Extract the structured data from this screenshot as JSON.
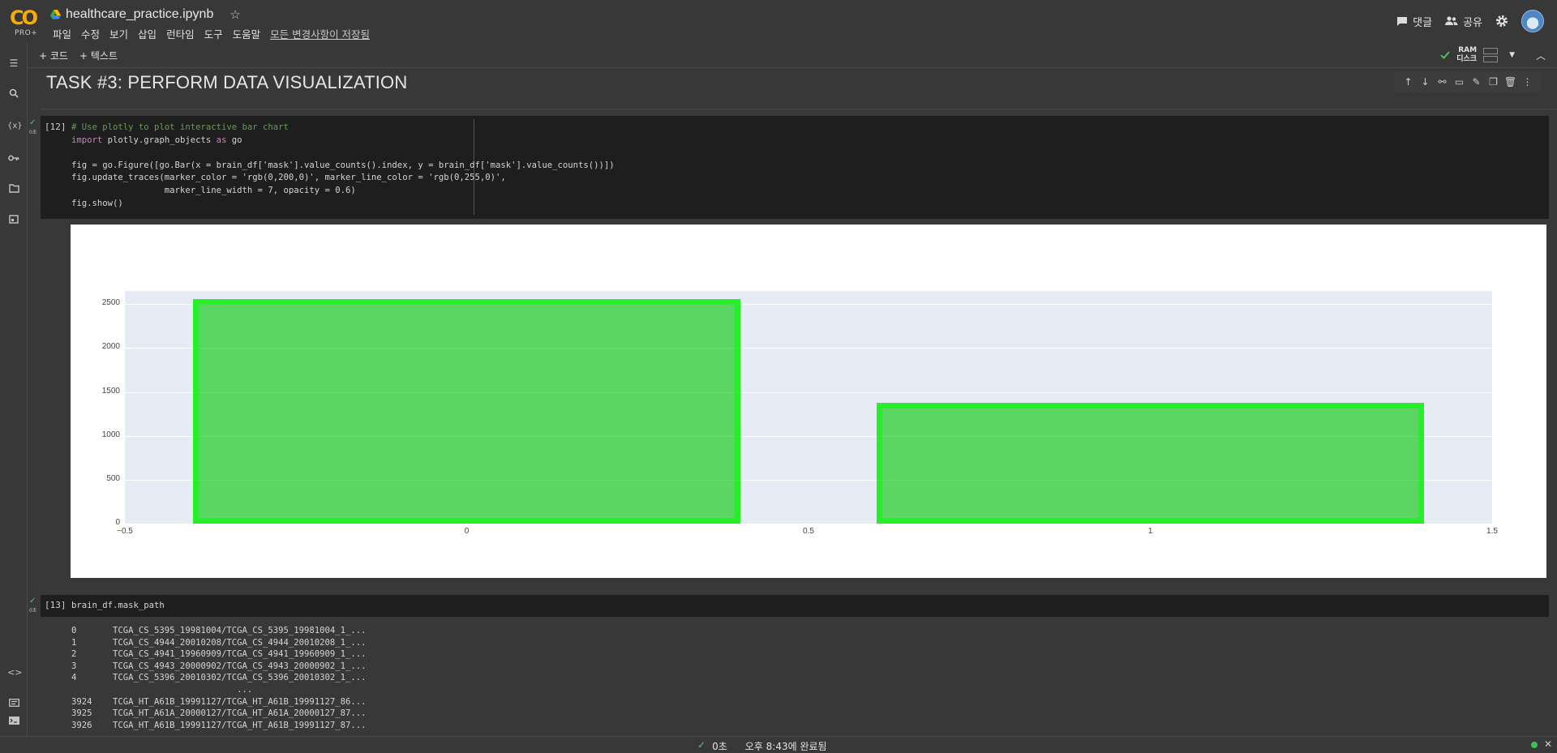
{
  "header": {
    "logo_text": "CO",
    "logo_badge": "PRO+",
    "notebook_title": "healthcare_practice.ipynb",
    "menu": [
      "파일",
      "수정",
      "보기",
      "삽입",
      "런타임",
      "도구",
      "도움말"
    ],
    "saved_status": "모든 변경사항이 저장됨",
    "comments_label": "댓글",
    "share_label": "공유"
  },
  "toolbar": {
    "add_code_label": "+ 코드",
    "add_text_label": "+ 텍스트",
    "ram_label": "RAM",
    "disk_label": "디스크"
  },
  "heading": "TASK #3: PERFORM DATA VISUALIZATION",
  "cell12": {
    "exec_count": "[12]",
    "run_time": "0초",
    "line1": "# Use plotly to plot interactive bar chart",
    "line2a": "import",
    "line2b": " plotly.graph_objects ",
    "line2c": "as",
    "line2d": " go",
    "line4": "fig = go.Figure([go.Bar(x = brain_df['mask'].value_counts().index, y = brain_df['mask'].value_counts())])",
    "line5": "fig.update_traces(marker_color = 'rgb(0,200,0)', marker_line_color = 'rgb(0,255,0)',",
    "line6": "                  marker_line_width = 7, opacity = 0.6)",
    "line7": "fig.show()"
  },
  "chart_data": {
    "type": "bar",
    "x": [
      0,
      1
    ],
    "values": [
      2556,
      1373
    ],
    "xlim": [
      -0.5,
      1.5
    ],
    "ylim": [
      0,
      2650
    ],
    "yticks": [
      0,
      500,
      1000,
      1500,
      2000,
      2500
    ],
    "xtick_labels": [
      "−0.5",
      "0",
      "0.5",
      "1",
      "1.5"
    ],
    "ytick_labels": [
      "0",
      "500",
      "1000",
      "1500",
      "2000",
      "2500"
    ],
    "marker_color": "rgb(0,200,0)",
    "marker_line_color": "rgb(0,255,0)",
    "opacity": 0.6,
    "grid": true
  },
  "cell13": {
    "exec_count": "[13]",
    "run_time": "0초",
    "code": "brain_df.mask_path"
  },
  "output13": [
    "0       TCGA_CS_5395_19981004/TCGA_CS_5395_19981004_1_...",
    "1       TCGA_CS_4944_20010208/TCGA_CS_4944_20010208_1_...",
    "2       TCGA_CS_4941_19960909/TCGA_CS_4941_19960909_1_...",
    "3       TCGA_CS_4943_20000902/TCGA_CS_4943_20000902_1_...",
    "4       TCGA_CS_5396_20010302/TCGA_CS_5396_20010302_1_...",
    "                                ...",
    "3924    TCGA_HT_A61B_19991127/TCGA_HT_A61B_19991127_86...",
    "3925    TCGA_HT_A61A_20000127/TCGA_HT_A61A_20000127_87...",
    "3926    TCGA_HT_A61B_19991127/TCGA_HT_A61B_19991127_87..."
  ],
  "status": {
    "elapsed": "0초",
    "completed": "오후 8:43에 완료됨"
  }
}
